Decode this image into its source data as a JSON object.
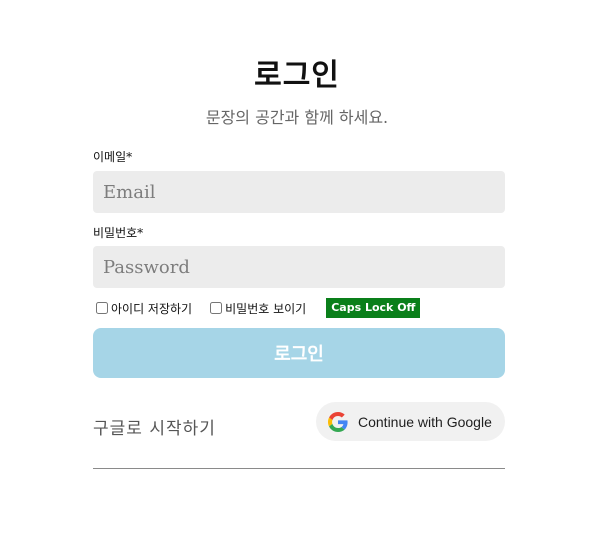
{
  "header": {
    "title": "로그인",
    "subtitle": "문장의 공간과 함께 하세요."
  },
  "form": {
    "email_label": "이메일*",
    "email_placeholder": "Email",
    "email_value": "",
    "password_label": "비밀번호*",
    "password_placeholder": "Password",
    "password_value": "",
    "remember_label": "아이디 저장하기",
    "remember_checked": false,
    "show_password_label": "비밀번호 보이기",
    "show_password_checked": false,
    "caps_lock_status": "Caps Lock Off",
    "login_button_label": "로그인"
  },
  "google": {
    "start_text": "구글로 시작하기",
    "button_label": "Continue with Google",
    "icon": "google-g-icon"
  },
  "colors": {
    "login_button_bg": "#a6d5e7",
    "input_bg": "#ececec",
    "caps_badge_bg": "#0a7f1a",
    "google_button_bg": "#f1f1f1"
  }
}
